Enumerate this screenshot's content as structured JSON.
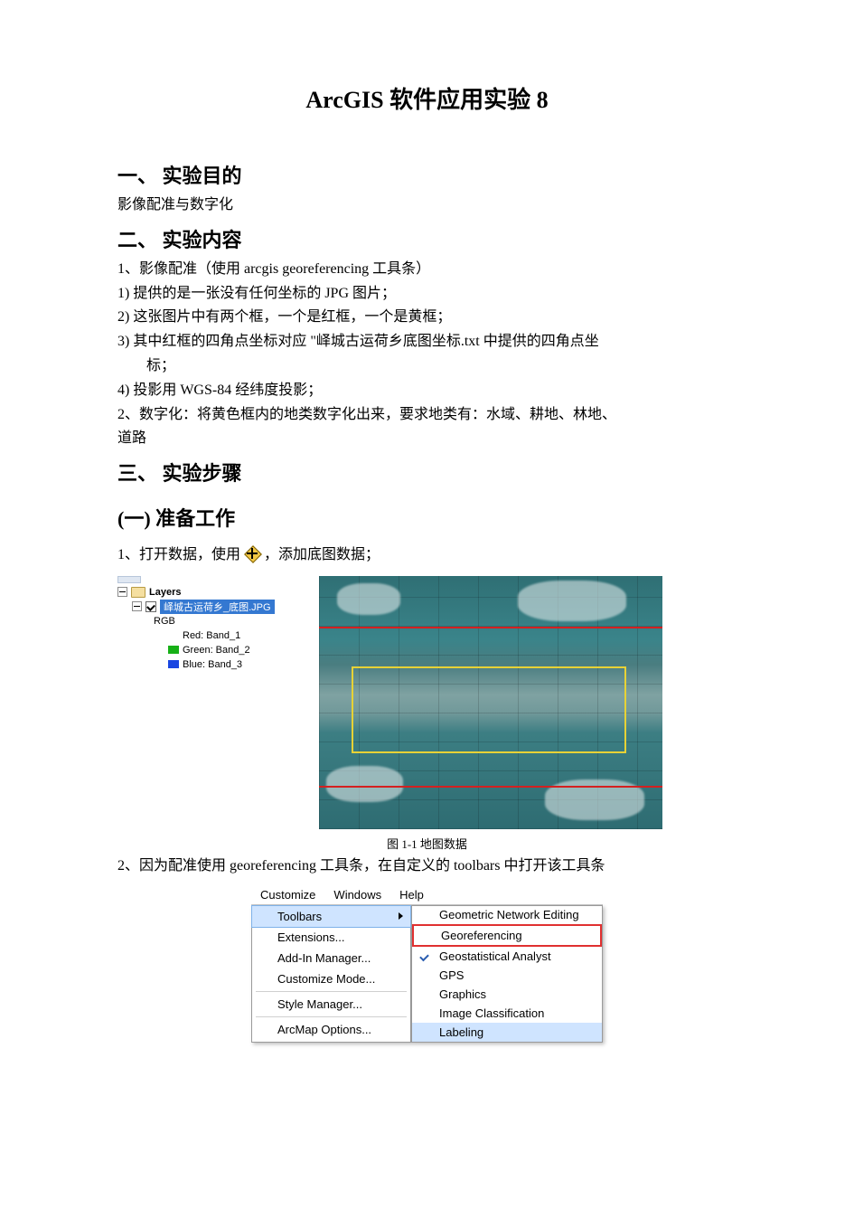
{
  "title": "ArcGIS 软件应用实验 8",
  "section1": {
    "heading": "一、  实验目的",
    "text": "影像配准与数字化"
  },
  "section2": {
    "heading": "二、  实验内容",
    "items": {
      "i1": "1、影像配准（使用 arcgis georeferencing  工具条）",
      "i1a": "1)  提供的是一张没有任何坐标的 JPG  图片；",
      "i1b": "2)  这张图片中有两个框，一个是红框，一个是黄框；",
      "i1c_a": "3)  其中红框的四角点坐标对应  \"峄城古运荷乡底图坐标.txt  中提供的四角点坐",
      "i1c_b": "标；",
      "i1d": "4)  投影用 WGS-84  经纬度投影；",
      "i2a": "2、数字化：将黄色框内的地类数字化出来，要求地类有：水域、耕地、林地、",
      "i2b": "道路"
    }
  },
  "section3": {
    "heading": "三、  实验步骤",
    "sub1": "(一)  准备工作",
    "step1_pre": "1、打开数据，使用",
    "step1_post": "，添加底图数据；",
    "fig1_caption": "图 1-1 地图数据",
    "step2": "2、因为配准使用 georeferencing 工具条，在自定义的 toolbars 中打开该工具条"
  },
  "layers_panel": {
    "root": "Layers",
    "layer_name": "峄城古运荷乡_底图.JPG",
    "rgb": "RGB",
    "bands": {
      "red": "Red: Band_1",
      "green": "Green: Band_2",
      "blue": "Blue: Band_3"
    },
    "colors": {
      "red": "#e11919",
      "green": "#17b017",
      "blue": "#1946e1"
    }
  },
  "menubar": {
    "customize": "Customize",
    "windows": "Windows",
    "help": "Help"
  },
  "customize_menu": {
    "toolbars": "Toolbars",
    "extensions": "Extensions...",
    "addin": "Add-In Manager...",
    "custmode": "Customize Mode...",
    "style": "Style Manager...",
    "options": "ArcMap Options..."
  },
  "toolbars_submenu": {
    "geom_net": "Geometric Network Editing",
    "georef": "Georeferencing",
    "geostat": "Geostatistical Analyst",
    "gps": "GPS",
    "graphics": "Graphics",
    "imgclass": "Image Classification",
    "labeling": "Labeling"
  }
}
